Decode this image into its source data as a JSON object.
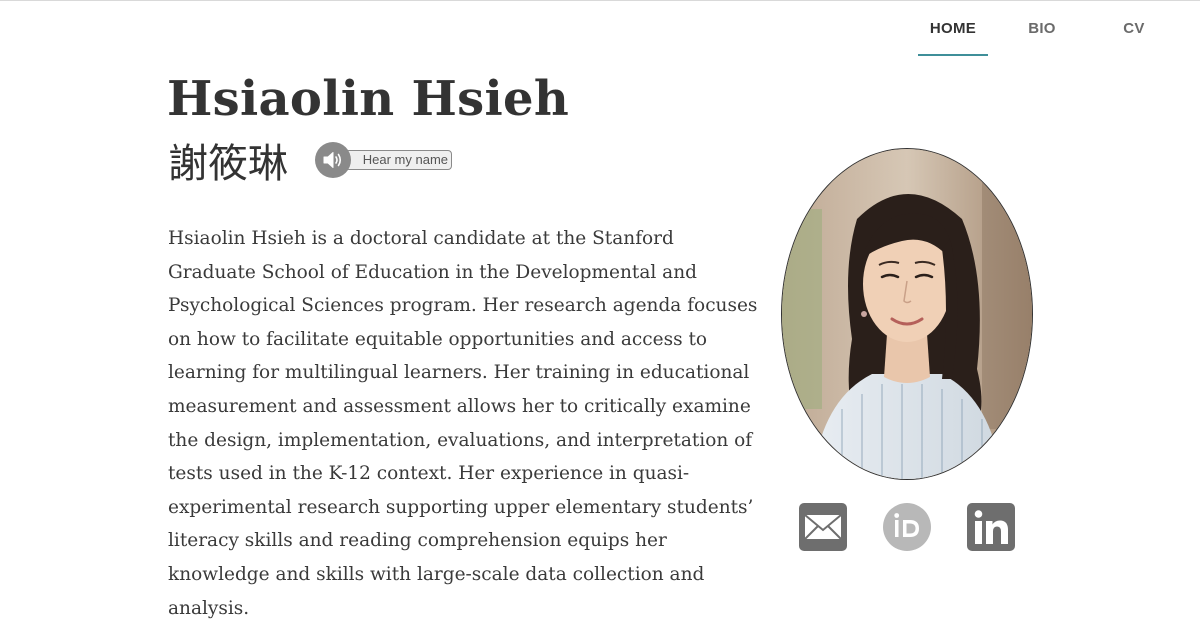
{
  "nav": {
    "items": [
      {
        "label": "HOME",
        "active": true
      },
      {
        "label": "BIO",
        "active": false
      },
      {
        "label": "CV",
        "active": false
      }
    ],
    "active_color": "#3f8f99"
  },
  "profile": {
    "name": "Hsiaolin Hsieh",
    "chinese_name": "謝筱琳",
    "hear_label": "Hear my name",
    "bio": "Hsiaolin Hsieh is a doctoral candidate at the Stanford Graduate School of Education in the Developmental and Psychological Sciences program. Her research agenda focuses on how to facilitate equitable opportunities and access to learning for multilingual learners. Her training in educational measurement and assessment allows her to critically examine the design, implementation, evaluations, and interpretation of tests used in the K-12 context. Her experience in quasi-experimental research supporting upper elementary students’ literacy skills and reading comprehension equips her knowledge and skills with large-scale data collection and analysis."
  },
  "social": {
    "icons": [
      "email-icon",
      "orcid-icon",
      "linkedin-icon"
    ],
    "icon_color": "#6e6e6e",
    "orcid_color": "#b8b8b8"
  }
}
